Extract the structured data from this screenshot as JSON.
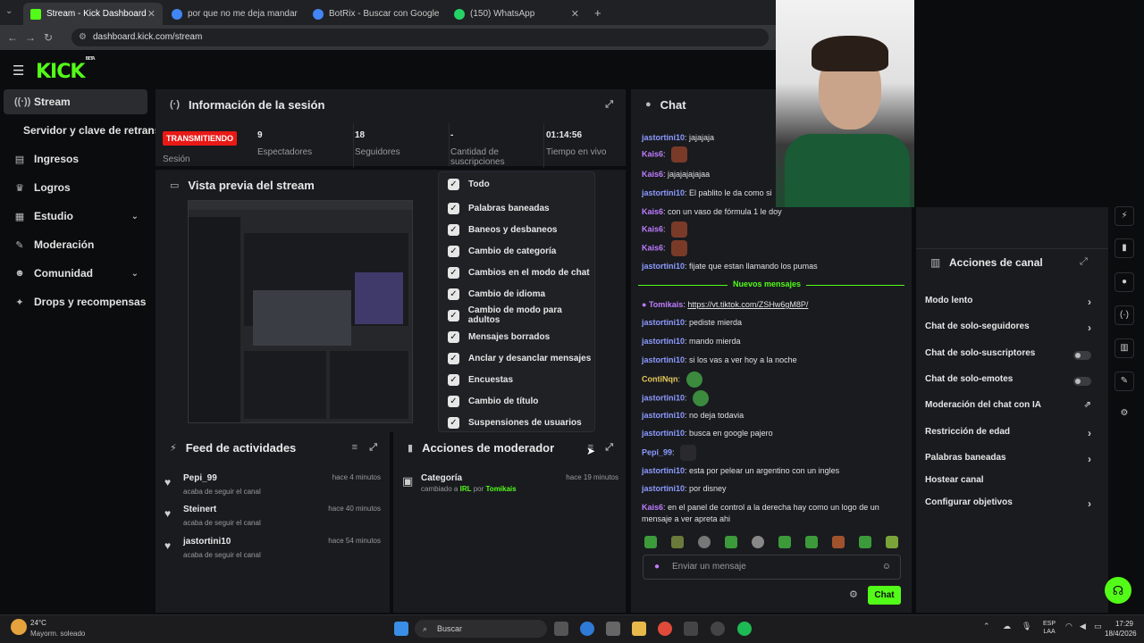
{
  "browser": {
    "tabs": [
      {
        "title": "Stream - Kick Dashboard",
        "active": true,
        "favicon": "#53fc18"
      },
      {
        "title": "por que no me deja mandar lin",
        "active": false,
        "favicon": "#4285f4"
      },
      {
        "title": "BotRix - Buscar con Google",
        "active": false,
        "favicon": "#4285f4"
      },
      {
        "title": "(150) WhatsApp",
        "active": false,
        "favicon": "#25d366"
      }
    ],
    "url": "dashboard.kick.com/stream"
  },
  "brand": {
    "logo": "KICK",
    "tag": "BETA",
    "accent": "#53fc18"
  },
  "sidebar": {
    "items": [
      {
        "label": "Stream",
        "icon": "broadcast-icon"
      },
      {
        "label": "Servidor y clave de retransn",
        "icon": ""
      },
      {
        "label": "Ingresos",
        "icon": "bars-icon"
      },
      {
        "label": "Logros",
        "icon": "trophy-icon"
      },
      {
        "label": "Estudio",
        "icon": "grid-icon"
      },
      {
        "label": "Moderación",
        "icon": "wrench-icon"
      },
      {
        "label": "Comunidad",
        "icon": "people-icon"
      },
      {
        "label": "Drops y recompensas",
        "icon": "gift-icon"
      }
    ]
  },
  "session": {
    "title": "Información de la sesión",
    "status": "TRANSMITIENDO",
    "status_label": "Sesión",
    "stats": [
      {
        "value": "9",
        "label": "Espectadores"
      },
      {
        "value": "18",
        "label": "Seguidores"
      },
      {
        "value": "-",
        "label": "Cantidad de suscripciones"
      },
      {
        "value": "01:14:56",
        "label": "Tiempo en vivo"
      }
    ]
  },
  "preview": {
    "title": "Vista previa del stream"
  },
  "filter_menu": {
    "items": [
      "Todo",
      "Palabras baneadas",
      "Baneos y desbaneos",
      "Cambio de categoría",
      "Cambios en el modo de chat",
      "Cambio de idioma",
      "Cambio de modo para adultos",
      "Mensajes borrados",
      "Anclar y desanclar mensajes",
      "Encuestas",
      "Cambio de título",
      "Suspensiones de usuarios"
    ]
  },
  "feed": {
    "title": "Feed de actividades",
    "items": [
      {
        "name": "Pepi_99",
        "sub": "acaba de seguir el canal",
        "time": "hace 4 minutos"
      },
      {
        "name": "Steinert",
        "sub": "acaba de seguir el canal",
        "time": "hace 40 minutos"
      },
      {
        "name": "jastortini10",
        "sub": "acaba de seguir el canal",
        "time": "hace 54 minutos"
      }
    ]
  },
  "modactions": {
    "title": "Acciones de moderador",
    "item": {
      "name": "Categoría",
      "pre": "cambiado a",
      "value": "IRL",
      "by": "por",
      "user": "Tomikais",
      "time": "hace 19 minutos"
    }
  },
  "chat": {
    "title": "Chat",
    "divider": "Nuevos mensajes",
    "messages_before": [
      {
        "user": "jastortini10",
        "color": "blue",
        "text": "jajajaja"
      },
      {
        "user": "Kais6",
        "color": "pink",
        "text": "",
        "emote": true
      },
      {
        "user": "Kais6",
        "color": "pink",
        "text": "jajajajajajaa"
      },
      {
        "user": "jastortini10",
        "color": "blue",
        "text": "El pablito le da como si"
      },
      {
        "user": "Kais6",
        "color": "pink",
        "text": "con un vaso de fórmula 1 le doy"
      },
      {
        "user": "Kais6",
        "color": "pink",
        "text": "",
        "emote": true
      },
      {
        "user": "Kais6",
        "color": "pink",
        "text": "",
        "emote": true
      },
      {
        "user": "jastortini10",
        "color": "blue",
        "text": "fijate que estan llamando los pumas"
      }
    ],
    "messages_after": [
      {
        "user": "Tomikais",
        "color": "pink",
        "text": "https://vt.tiktok.com/ZSHw6gM8P/"
      },
      {
        "user": "jastortini10",
        "color": "blue",
        "text": "pediste mierda"
      },
      {
        "user": "jastortini10",
        "color": "blue",
        "text": "mando mierda"
      },
      {
        "user": "jastortini10",
        "color": "blue",
        "text": "si los vas a ver hoy a la noche"
      },
      {
        "user": "ContiNqn",
        "color": "yellow",
        "text": "",
        "emote": true
      },
      {
        "user": "jastortini10",
        "color": "blue",
        "text": "",
        "emote": true
      },
      {
        "user": "jastortini10",
        "color": "blue",
        "text": "no deja todavia"
      },
      {
        "user": "jastortini10",
        "color": "blue",
        "text": "busca en google pajero"
      },
      {
        "user": "Pepi_99",
        "color": "blue",
        "text": "",
        "emote": true
      },
      {
        "user": "jastortini10",
        "color": "blue",
        "text": "esta por pelear un argentino con un ingles"
      },
      {
        "user": "jastortini10",
        "color": "blue",
        "text": "por disney"
      },
      {
        "user": "Kais6",
        "color": "pink",
        "text": "en el panel de control a la derecha hay como un logo de un mensaje a ver apreta ahi"
      }
    ],
    "input_placeholder": "Enviar un mensaje",
    "send_label": "Chat"
  },
  "channel_actions": {
    "title": "Acciones de canal",
    "items": [
      {
        "label": "Modo lento",
        "control": "chevron"
      },
      {
        "label": "Chat de solo-seguidores",
        "control": "chevron"
      },
      {
        "label": "Chat de solo-suscriptores",
        "control": "toggle"
      },
      {
        "label": "Chat de solo-emotes",
        "control": "toggle"
      },
      {
        "label": "Moderación del chat con IA",
        "control": "external"
      },
      {
        "label": "Restricción de edad",
        "control": "chevron"
      },
      {
        "label": "Palabras baneadas",
        "control": "chevron"
      },
      {
        "label": "Hostear canal",
        "control": "none"
      },
      {
        "label": "Configurar objetivos",
        "control": "chevron"
      }
    ]
  },
  "taskbar": {
    "weather_temp": "24°C",
    "weather_desc": "Mayorm. soleado",
    "search": "Buscar",
    "lang1": "ESP",
    "lang2": "LAA",
    "time": "17:29",
    "date": "18/4/2026"
  }
}
